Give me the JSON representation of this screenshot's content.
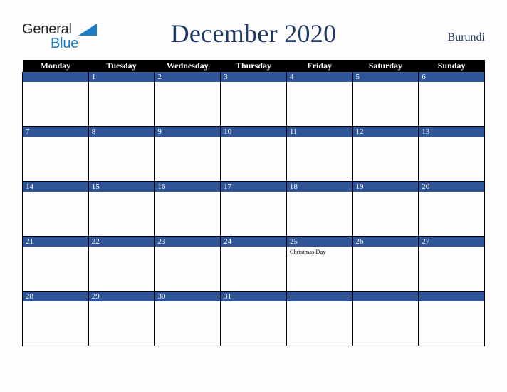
{
  "brand": {
    "name_part1": "General",
    "name_part2": "Blue",
    "color_primary": "#1b7dc4",
    "color_text": "#231f20"
  },
  "header": {
    "title": "December 2020",
    "country": "Burundi",
    "title_color": "#1f3864"
  },
  "calendar": {
    "header_background": "#000000",
    "daynum_background": "#2f5597",
    "weekday_headers": [
      "Monday",
      "Tuesday",
      "Wednesday",
      "Thursday",
      "Friday",
      "Saturday",
      "Sunday"
    ],
    "weeks": [
      [
        {
          "day": "",
          "events": []
        },
        {
          "day": "1",
          "events": []
        },
        {
          "day": "2",
          "events": []
        },
        {
          "day": "3",
          "events": []
        },
        {
          "day": "4",
          "events": []
        },
        {
          "day": "5",
          "events": []
        },
        {
          "day": "6",
          "events": []
        }
      ],
      [
        {
          "day": "7",
          "events": []
        },
        {
          "day": "8",
          "events": []
        },
        {
          "day": "9",
          "events": []
        },
        {
          "day": "10",
          "events": []
        },
        {
          "day": "11",
          "events": []
        },
        {
          "day": "12",
          "events": []
        },
        {
          "day": "13",
          "events": []
        }
      ],
      [
        {
          "day": "14",
          "events": []
        },
        {
          "day": "15",
          "events": []
        },
        {
          "day": "16",
          "events": []
        },
        {
          "day": "17",
          "events": []
        },
        {
          "day": "18",
          "events": []
        },
        {
          "day": "19",
          "events": []
        },
        {
          "day": "20",
          "events": []
        }
      ],
      [
        {
          "day": "21",
          "events": []
        },
        {
          "day": "22",
          "events": []
        },
        {
          "day": "23",
          "events": []
        },
        {
          "day": "24",
          "events": []
        },
        {
          "day": "25",
          "events": [
            "Christmas Day"
          ]
        },
        {
          "day": "26",
          "events": []
        },
        {
          "day": "27",
          "events": []
        }
      ],
      [
        {
          "day": "28",
          "events": []
        },
        {
          "day": "29",
          "events": []
        },
        {
          "day": "30",
          "events": []
        },
        {
          "day": "31",
          "events": []
        },
        {
          "day": "",
          "events": []
        },
        {
          "day": "",
          "events": []
        },
        {
          "day": "",
          "events": []
        }
      ]
    ]
  }
}
